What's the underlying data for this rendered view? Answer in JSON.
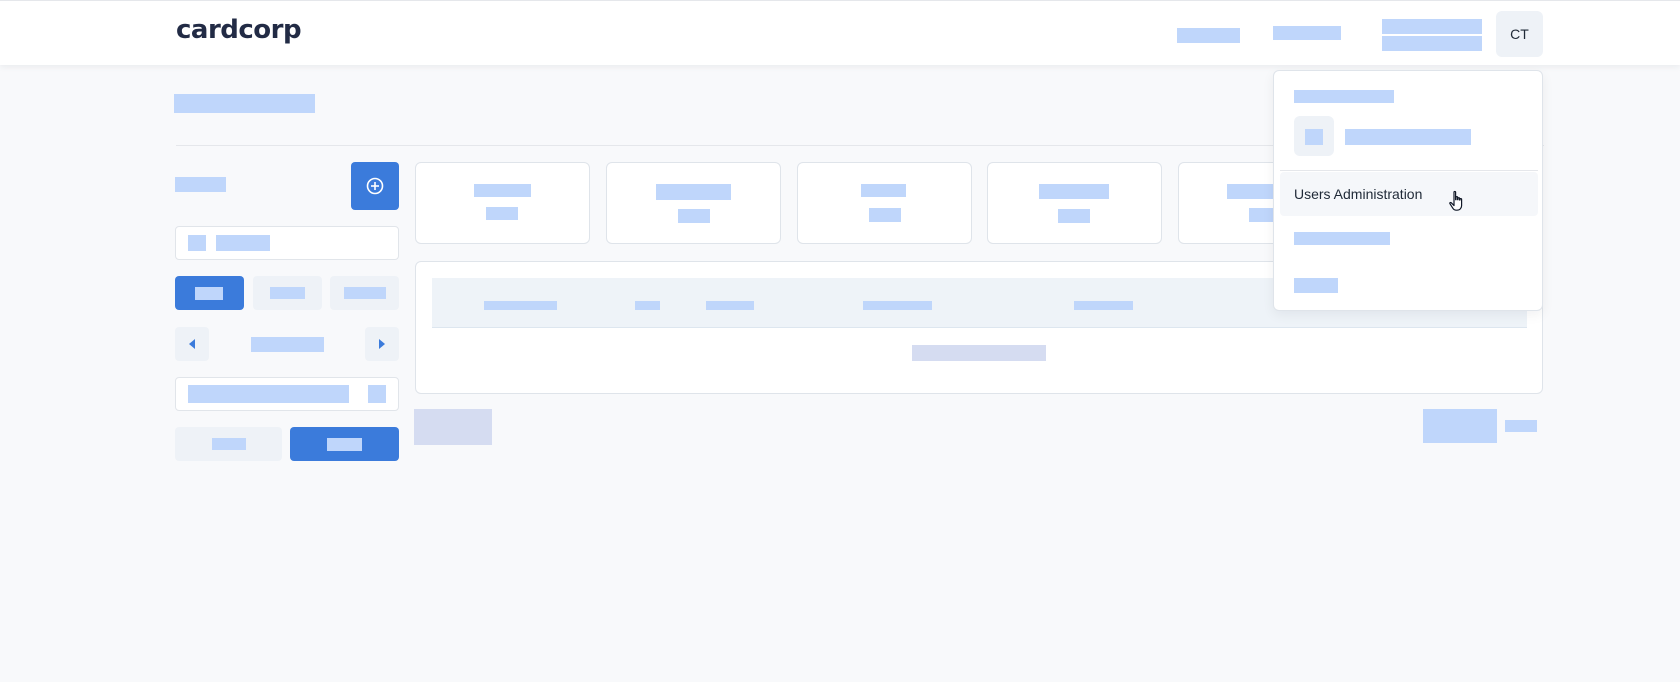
{
  "header": {
    "logo": "cardcorp",
    "avatar_initials": "CT"
  },
  "user_menu": {
    "items": [
      {
        "label": "Users Administration",
        "highlighted": true
      }
    ]
  },
  "colors": {
    "primary": "#3b7bdb",
    "placeholder": "#bfd6fb",
    "brand_text": "#222b45"
  },
  "icons": [
    "plus-circle-icon",
    "chevron-left-icon",
    "chevron-right-icon",
    "hand-pointer-icon"
  ]
}
